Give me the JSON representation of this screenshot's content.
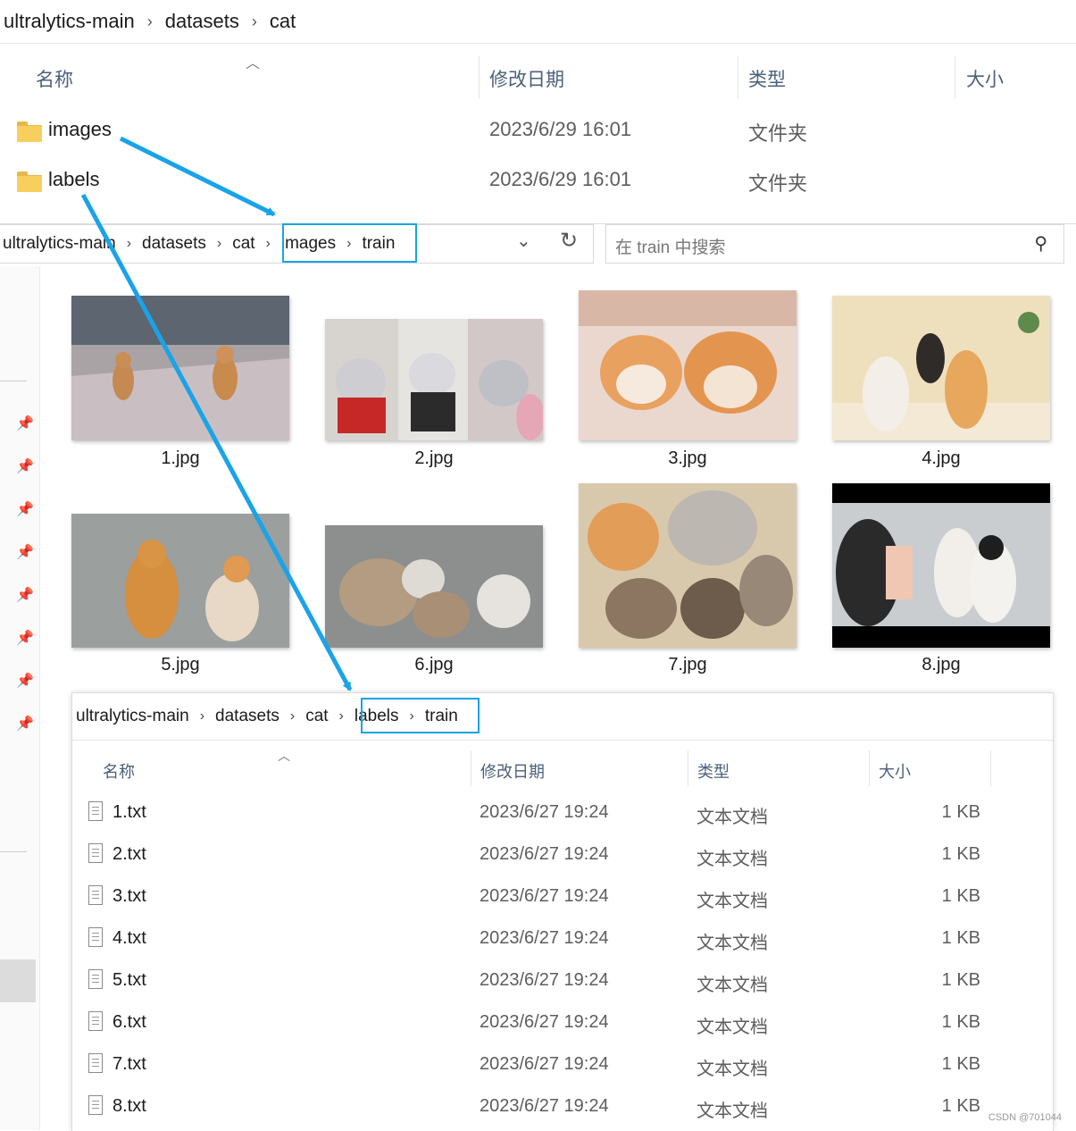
{
  "top": {
    "breadcrumb": [
      "ultralytics-main",
      "datasets",
      "cat"
    ],
    "headers": {
      "name": "名称",
      "date": "修改日期",
      "type": "类型",
      "size": "大小"
    },
    "rows": [
      {
        "name": "images",
        "date": "2023/6/29 16:01",
        "type": "文件夹"
      },
      {
        "name": "labels",
        "date": "2023/6/29 16:01",
        "type": "文件夹"
      }
    ]
  },
  "mid": {
    "breadcrumb": [
      "ultralytics-main",
      "datasets",
      "cat",
      "images",
      "train"
    ],
    "search_placeholder": "在 train 中搜索",
    "thumbnails": [
      "1.jpg",
      "2.jpg",
      "3.jpg",
      "4.jpg",
      "5.jpg",
      "6.jpg",
      "7.jpg",
      "8.jpg"
    ]
  },
  "bottom": {
    "breadcrumb": [
      "ultralytics-main",
      "datasets",
      "cat",
      "labels",
      "train"
    ],
    "headers": {
      "name": "名称",
      "date": "修改日期",
      "type": "类型",
      "size": "大小"
    },
    "rows": [
      {
        "name": "1.txt",
        "date": "2023/6/27 19:24",
        "type": "文本文档",
        "size": "1 KB"
      },
      {
        "name": "2.txt",
        "date": "2023/6/27 19:24",
        "type": "文本文档",
        "size": "1 KB"
      },
      {
        "name": "3.txt",
        "date": "2023/6/27 19:24",
        "type": "文本文档",
        "size": "1 KB"
      },
      {
        "name": "4.txt",
        "date": "2023/6/27 19:24",
        "type": "文本文档",
        "size": "1 KB"
      },
      {
        "name": "5.txt",
        "date": "2023/6/27 19:24",
        "type": "文本文档",
        "size": "1 KB"
      },
      {
        "name": "6.txt",
        "date": "2023/6/27 19:24",
        "type": "文本文档",
        "size": "1 KB"
      },
      {
        "name": "7.txt",
        "date": "2023/6/27 19:24",
        "type": "文本文档",
        "size": "1 KB"
      },
      {
        "name": "8.txt",
        "date": "2023/6/27 19:24",
        "type": "文本文档",
        "size": "1 KB"
      }
    ]
  },
  "watermark": "CSDN @701044",
  "colors": {
    "highlight": "#1aa3e8",
    "folder": "#f8cf5c"
  },
  "icons": {
    "folder": "folder-icon",
    "text_file": "text-file-icon",
    "pin": "pin-icon",
    "search": "search-icon",
    "refresh": "refresh-icon",
    "chevron": "chevron-down-icon"
  }
}
